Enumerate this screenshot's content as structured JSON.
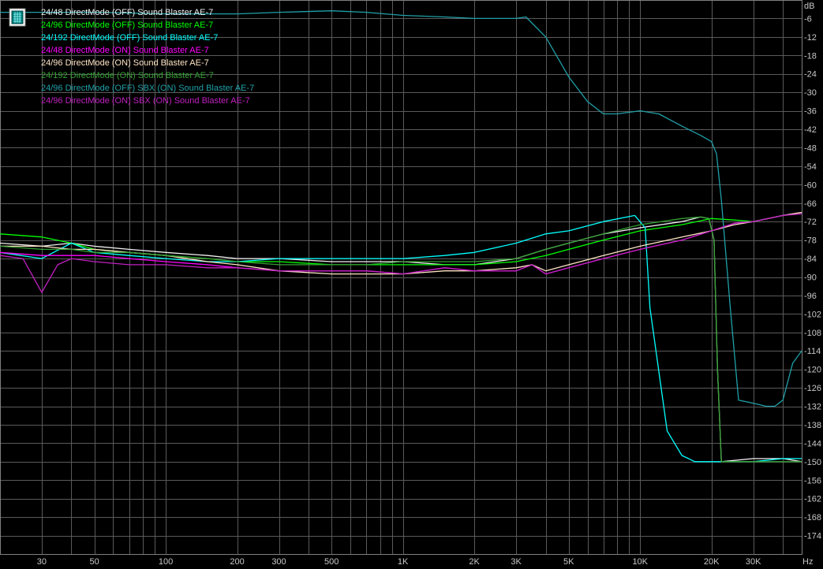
{
  "chart_data": {
    "type": "line",
    "x_scale": "log",
    "x_unit": "Hz",
    "y_unit": "dB",
    "xlim": [
      20,
      48000
    ],
    "ylim": [
      -180,
      0
    ],
    "grid": true,
    "legend_placement": "top-left",
    "x_ticks": [
      {
        "value": 30,
        "label": "30"
      },
      {
        "value": 50,
        "label": "50"
      },
      {
        "value": 100,
        "label": "100"
      },
      {
        "value": 200,
        "label": "200"
      },
      {
        "value": 300,
        "label": "300"
      },
      {
        "value": 500,
        "label": "500"
      },
      {
        "value": 1000,
        "label": "1K"
      },
      {
        "value": 2000,
        "label": "2K"
      },
      {
        "value": 3000,
        "label": "3K"
      },
      {
        "value": 5000,
        "label": "5K"
      },
      {
        "value": 10000,
        "label": "10K"
      },
      {
        "value": 20000,
        "label": "20K"
      },
      {
        "value": 30000,
        "label": "30K"
      }
    ],
    "y_ticks": [
      -6,
      -12,
      -18,
      -24,
      -30,
      -36,
      -42,
      -48,
      -54,
      -60,
      -66,
      -72,
      -78,
      -84,
      -90,
      -96,
      -102,
      -108,
      -114,
      -120,
      -126,
      -132,
      -138,
      -144,
      -150,
      -156,
      -162,
      -168,
      -174
    ],
    "series": [
      {
        "name": "24/48 DirectMode (OFF) Sound Blaster AE-7",
        "color": "#f0f0f0",
        "x": [
          20,
          30,
          40,
          50,
          70,
          100,
          150,
          200,
          300,
          500,
          700,
          1000,
          1500,
          2000,
          3000,
          4000,
          5000,
          7000,
          10000,
          15000,
          18000,
          19500,
          20500,
          21200,
          22000,
          30000,
          40000,
          48000
        ],
        "y": [
          -79,
          -80,
          -79,
          -80,
          -81,
          -82,
          -83,
          -84,
          -84,
          -85,
          -85,
          -85,
          -86,
          -86,
          -84,
          -81,
          -79,
          -76,
          -74,
          -72,
          -70.5,
          -71,
          -78,
          -120,
          -150,
          -149,
          -149,
          -150
        ]
      },
      {
        "name": "24/96 DirectMode (OFF) Sound Blaster AE-7",
        "color": "#00ff00",
        "x": [
          20,
          30,
          40,
          50,
          70,
          100,
          150,
          200,
          300,
          500,
          700,
          1000,
          1500,
          2000,
          3000,
          4000,
          5000,
          7000,
          10000,
          15000,
          20000,
          25000,
          30000,
          40000,
          48000
        ],
        "y": [
          -76,
          -77,
          -79,
          -81,
          -82,
          -83,
          -84,
          -85,
          -85,
          -86,
          -86,
          -86,
          -86,
          -86,
          -85,
          -83,
          -81,
          -78,
          -75,
          -73,
          -71,
          -71.5,
          -72,
          -70,
          -69
        ]
      },
      {
        "name": "24/192 DirectMode (OFF) Sound Blaster AE-7",
        "color": "#00ffff",
        "x": [
          20,
          30,
          40,
          50,
          70,
          100,
          150,
          200,
          300,
          500,
          700,
          1000,
          1500,
          2000,
          3000,
          4000,
          5000,
          7000,
          9500,
          10500,
          11000,
          13000,
          15000,
          16000,
          17000,
          20000,
          25000,
          30000,
          40000,
          48000
        ],
        "y": [
          -82,
          -84,
          -79,
          -82,
          -83,
          -84,
          -85,
          -85,
          -84,
          -84,
          -84,
          -84,
          -83,
          -82,
          -79,
          -76,
          -75,
          -72,
          -70,
          -74,
          -100,
          -140,
          -148,
          -149,
          -150,
          -150,
          -150,
          -150,
          -149,
          -149
        ]
      },
      {
        "name": "24/48 DirectMode (ON) Sound Blaster AE-7",
        "color": "#ff00ff",
        "x": [
          20,
          30,
          40,
          50,
          70,
          100,
          150,
          200,
          300,
          500,
          700,
          1000,
          1500,
          2000,
          3000,
          3500,
          4000,
          5000,
          7000,
          10000,
          15000,
          20000,
          25000,
          30000,
          40000,
          48000
        ],
        "y": [
          -82,
          -83,
          -83,
          -83,
          -84,
          -85,
          -86,
          -87,
          -88,
          -88,
          -88,
          -89,
          -87,
          -88,
          -88,
          -86,
          -89,
          -87,
          -84,
          -81,
          -78,
          -75,
          -72.5,
          -72,
          -70,
          -69
        ]
      },
      {
        "name": "24/96 DirectMode (ON) Sound Blaster AE-7",
        "color": "#ffe4c4",
        "x": [
          20,
          30,
          40,
          50,
          70,
          100,
          150,
          200,
          300,
          500,
          700,
          1000,
          1500,
          2000,
          3000,
          3500,
          4000,
          5000,
          7000,
          10000,
          15000,
          20000,
          25000,
          30000,
          40000,
          48000
        ],
        "y": [
          -80,
          -80,
          -81,
          -81,
          -82,
          -83,
          -85,
          -86,
          -88,
          -89,
          -89,
          -89,
          -88,
          -88,
          -87,
          -86,
          -88,
          -86,
          -83,
          -80,
          -77,
          -75,
          -73,
          -72,
          -70,
          -69
        ]
      },
      {
        "name": "24/192 DirectMode (ON) Sound Blaster AE-7",
        "color": "#33a033",
        "x": [
          20,
          30,
          40,
          50,
          70,
          100,
          150,
          200,
          300,
          500,
          700,
          1000,
          1500,
          2000,
          3000,
          4000,
          5000,
          7000,
          10000,
          15000,
          18000,
          19500,
          20500,
          21200,
          22000,
          30000,
          40000,
          48000
        ],
        "y": [
          -80,
          -81,
          -81,
          -82,
          -82,
          -83,
          -84,
          -85,
          -86,
          -86,
          -86,
          -85,
          -85,
          -85,
          -84,
          -81,
          -79,
          -76,
          -73,
          -71,
          -70.5,
          -71,
          -78,
          -120,
          -150,
          -150,
          -150,
          -150
        ]
      },
      {
        "name": "24/96 DirectMode (OFF) SBX (ON) Sound Blaster AE-7",
        "color": "#20a0a8",
        "x": [
          20,
          50,
          100,
          200,
          300,
          500,
          700,
          1000,
          1500,
          2000,
          3000,
          3300,
          4000,
          5000,
          6000,
          7000,
          8000,
          10000,
          12000,
          15000,
          18000,
          20000,
          21000,
          22000,
          24000,
          26000,
          30000,
          34000,
          37000,
          40000,
          44000,
          48000
        ],
        "y": [
          -4,
          -4,
          -4.5,
          -4.5,
          -4,
          -3.5,
          -4,
          -5,
          -5.5,
          -6,
          -6,
          -5.5,
          -12,
          -25,
          -33,
          -37,
          -37,
          -36,
          -37,
          -41,
          -44,
          -46,
          -50,
          -65,
          -100,
          -130,
          -131,
          -132,
          -132,
          -130,
          -118,
          -114
        ]
      },
      {
        "name": "24/96 DirectMode (ON) SBX (ON) Sound Blaster AE-7",
        "color": "#c020c0",
        "x": [
          20,
          25,
          30,
          35,
          40,
          50,
          70,
          100,
          150,
          200,
          300,
          500,
          700,
          1000,
          1500,
          2000,
          3000,
          3500,
          4000,
          5000,
          7000,
          10000,
          15000,
          20000,
          25000,
          30000,
          40000,
          48000
        ],
        "y": [
          -83,
          -84,
          -95,
          -86,
          -84,
          -85,
          -86,
          -86,
          -87,
          -87,
          -88,
          -88,
          -88,
          -89,
          -87,
          -88,
          -88,
          -86,
          -89,
          -87,
          -84,
          -81,
          -78,
          -75,
          -72.5,
          -72,
          -70,
          -69.5
        ]
      }
    ]
  }
}
